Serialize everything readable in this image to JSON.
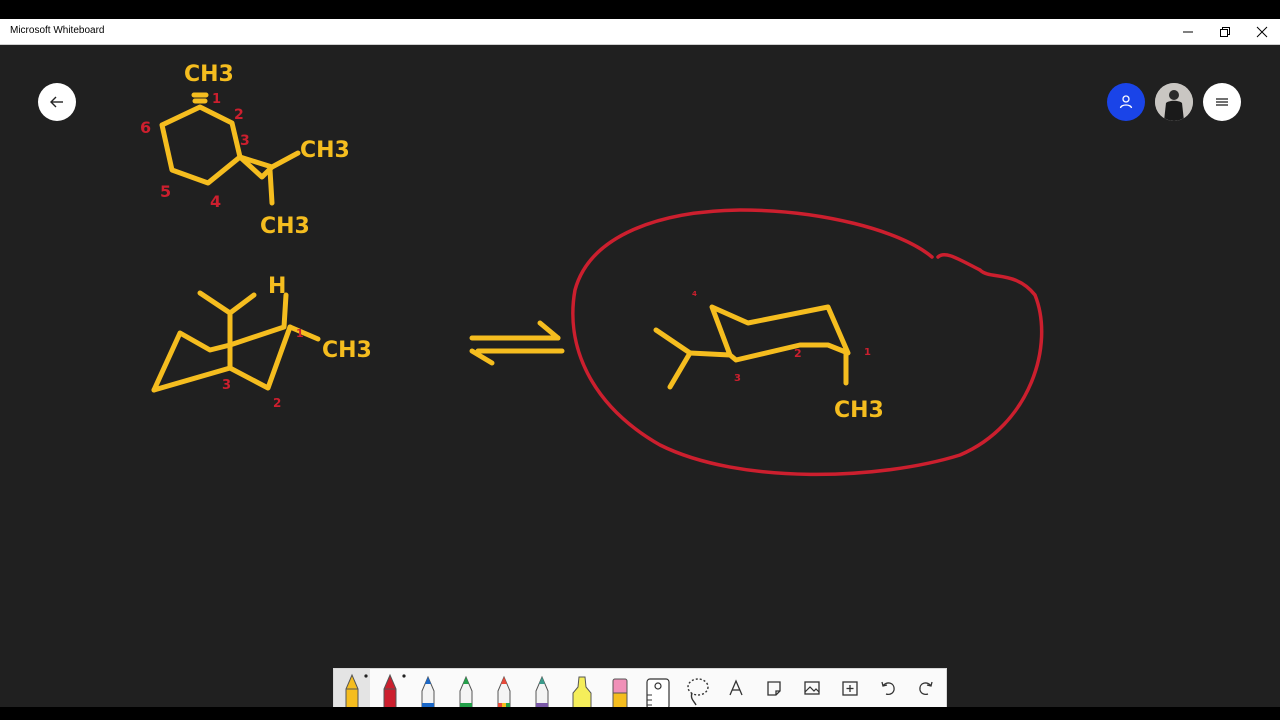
{
  "window": {
    "title": "Microsoft Whiteboard",
    "controls": [
      "minimize-icon",
      "restore-icon",
      "close-icon"
    ]
  },
  "header": {
    "back_icon": "arrow-left-icon",
    "invite_icon": "person-icon",
    "avatar": "user-avatar",
    "menu_icon": "hamburger-menu-icon",
    "invite_color": "#1a44e8"
  },
  "ink_colors": {
    "yellow": "#f5bd1f",
    "red": "#cc1f2e",
    "canvas": "#202020"
  },
  "whiteboard": {
    "structure_top": {
      "labels": [
        "CH3",
        "CH3",
        "CH3"
      ],
      "numbers": [
        "1",
        "2",
        "3",
        "4",
        "5",
        "6"
      ]
    },
    "structure_chair_left": {
      "labels": [
        "H",
        "CH3"
      ],
      "numbers": [
        "1",
        "2",
        "3"
      ]
    },
    "equilibrium_arrow": "equilibrium-arrow",
    "structure_chair_right": {
      "labels": [
        "CH3"
      ],
      "numbers": [
        "1",
        "2",
        "3",
        "4"
      ]
    }
  },
  "toolbar": {
    "tools": [
      {
        "name": "pen-yellow",
        "color": "#f5bd1f",
        "selected": true
      },
      {
        "name": "pen-red",
        "color": "#cc1f2e",
        "selected": false
      },
      {
        "name": "pen-blue",
        "color": "#1b68c8",
        "selected": false
      },
      {
        "name": "pen-green",
        "color": "#23a04a",
        "selected": false
      },
      {
        "name": "pen-rainbow",
        "color": "#e84a3a",
        "selected": false
      },
      {
        "name": "pen-galaxy",
        "color": "#3a9c8c",
        "selected": false
      },
      {
        "name": "highlighter",
        "color": "#f5ee5a",
        "selected": false
      },
      {
        "name": "eraser",
        "color": "#f090b8",
        "selected": false
      },
      {
        "name": "ruler",
        "color": "#ffffff",
        "selected": false
      },
      {
        "name": "lasso",
        "color": "#333333",
        "selected": false
      }
    ],
    "actions": [
      "text-icon",
      "note-icon",
      "image-icon",
      "add-icon",
      "undo-icon",
      "redo-icon"
    ]
  }
}
